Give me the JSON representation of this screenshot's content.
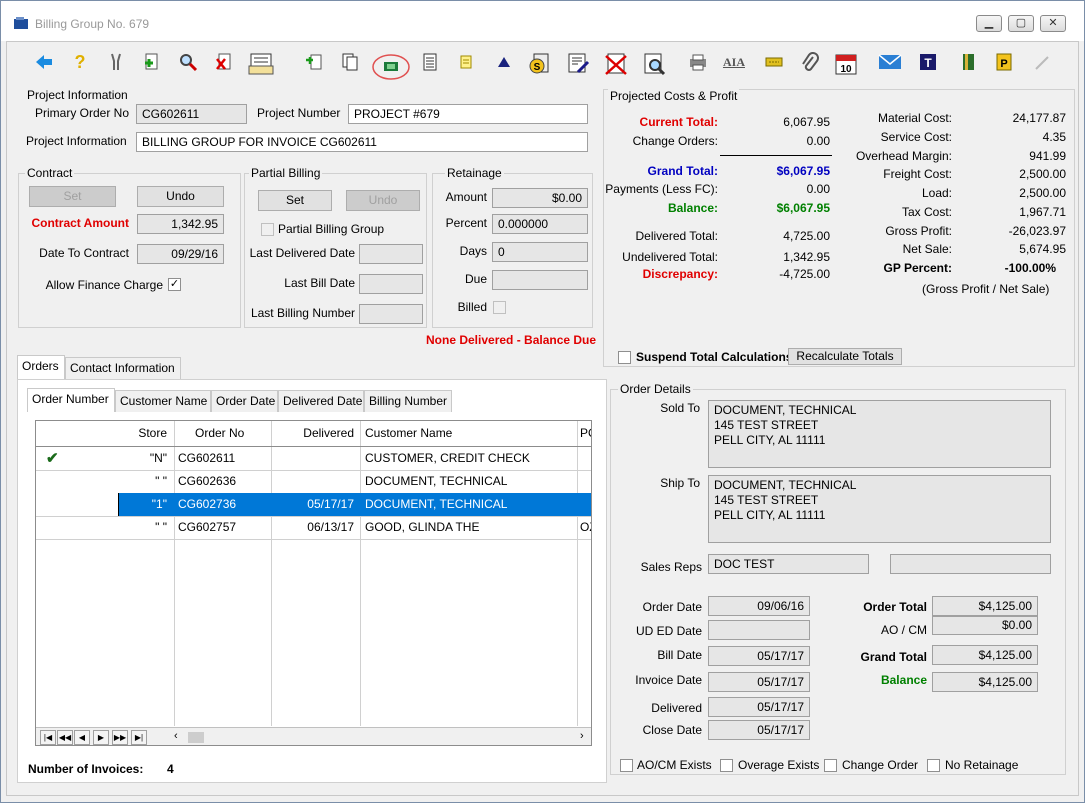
{
  "window": {
    "title": "Billing Group No. 679"
  },
  "toolbar": {
    "icons": [
      "back-arrow-icon",
      "help-icon",
      "tools-icon",
      "add-document-icon",
      "search-icon",
      "delete-document-icon",
      "report-stack-icon",
      "import-document-icon",
      "copy-documents-icon",
      "money-bill-icon",
      "document-lines-icon",
      "note-icon",
      "triangle-icon",
      "dollar-invoice-icon",
      "edit-document-icon",
      "cancel-document-icon",
      "preview-icon",
      "print-icon",
      "aia-icon",
      "ticket-icon",
      "paperclip-icon",
      "calendar-icon",
      "email-icon",
      "t-icon",
      "book-icon",
      "p-icon",
      "pencil-icon"
    ],
    "aia_label": "AIA",
    "calendar_label": "10"
  },
  "project_information": {
    "title": "Project Information",
    "primary_order_label": "Primary Order No",
    "primary_order_value": "CG602611",
    "project_number_label": "Project Number",
    "project_number_value": "PROJECT #679",
    "project_information_label": "Project Information",
    "project_information_value": "BILLING GROUP FOR INVOICE CG602611"
  },
  "contract": {
    "title": "Contract",
    "set_label": "Set",
    "undo_label": "Undo",
    "contract_amount_label": "Contract Amount",
    "contract_amount_value": "1,342.95",
    "date_to_contract_label": "Date To Contract",
    "date_to_contract_value": "09/29/16",
    "allow_finance_label": "Allow Finance Charge",
    "allow_finance_checked": "✓"
  },
  "partial_billing": {
    "title": "Partial Billing",
    "set_label": "Set",
    "undo_label": "Undo",
    "group_label": "Partial Billing Group",
    "last_delivered_label": "Last Delivered Date",
    "last_bill_label": "Last Bill Date",
    "last_billing_number_label": "Last Billing Number"
  },
  "retainage": {
    "title": "Retainage",
    "amount_label": "Amount",
    "amount_value": "$0.00",
    "percent_label": "Percent",
    "percent_value": "0.000000",
    "days_label": "Days",
    "days_value": "0",
    "due_label": "Due",
    "billed_label": "Billed"
  },
  "status_message": "None Delivered - Balance Due",
  "projected": {
    "title": "Projected Costs & Profit",
    "left": [
      {
        "label": "Current Total:",
        "value": "6,067.95"
      },
      {
        "label": "Change Orders:",
        "value": "0.00"
      },
      {
        "label": "Grand Total:",
        "value": "$6,067.95"
      },
      {
        "label": "Payments (Less FC):",
        "value": "0.00"
      },
      {
        "label": "Balance:",
        "value": "$6,067.95"
      },
      {
        "label": "Delivered Total:",
        "value": "4,725.00"
      },
      {
        "label": "Undelivered Total:",
        "value": "1,342.95"
      },
      {
        "label": "Discrepancy:",
        "value": "-4,725.00"
      }
    ],
    "right": [
      {
        "label": "Material Cost:",
        "value": "24,177.87"
      },
      {
        "label": "Service Cost:",
        "value": "4.35"
      },
      {
        "label": "Overhead Margin:",
        "value": "941.99"
      },
      {
        "label": "Freight Cost:",
        "value": "2,500.00"
      },
      {
        "label": "Load:",
        "value": "2,500.00"
      },
      {
        "label": "Tax Cost:",
        "value": "1,967.71"
      },
      {
        "label": "Gross Profit:",
        "value": "-26,023.97"
      },
      {
        "label": "Net Sale:",
        "value": "5,674.95"
      },
      {
        "label": "GP Percent:",
        "value": "-100.00%"
      }
    ],
    "gp_note": "(Gross Profit / Net Sale)",
    "suspend_label": "Suspend Total Calculations",
    "recalculate_label": "Recalculate Totals"
  },
  "main_tabs": [
    "Orders",
    "Contact Information"
  ],
  "order_tabs": [
    "Order Number",
    "Customer Name",
    "Order Date",
    "Delivered Date",
    "Billing Number"
  ],
  "grid": {
    "columns": [
      "Store",
      "Order No",
      "Delivered",
      "Customer Name",
      "PO"
    ],
    "rows": [
      {
        "mark": "✔",
        "store": "\"N\"",
        "order_no": "CG602611",
        "delivered": "",
        "customer": "CUSTOMER, CREDIT CHECK",
        "po": ""
      },
      {
        "mark": "",
        "store": "\" \"",
        "order_no": "CG602636",
        "delivered": "",
        "customer": "DOCUMENT, TECHNICAL",
        "po": ""
      },
      {
        "mark": "",
        "store": "\"1\"",
        "order_no": "CG602736",
        "delivered": "05/17/17",
        "customer": "DOCUMENT, TECHNICAL",
        "po": ""
      },
      {
        "mark": "",
        "store": "\" \"",
        "order_no": "CG602757",
        "delivered": "06/13/17",
        "customer": "GOOD, GLINDA THE",
        "po": "OZ"
      }
    ],
    "nav": [
      "|◀",
      "◀◀",
      "◀",
      "▶",
      "▶▶",
      "▶|"
    ]
  },
  "invoices": {
    "label": "Number of Invoices:",
    "value": "4"
  },
  "order_details": {
    "title": "Order Details",
    "sold_to_label": "Sold To",
    "sold_to": [
      "DOCUMENT, TECHNICAL",
      "145 TEST STREET",
      "PELL CITY, AL  11111"
    ],
    "ship_to_label": "Ship To",
    "ship_to": [
      "DOCUMENT, TECHNICAL",
      "145 TEST STREET",
      "PELL CITY, AL  11111"
    ],
    "sales_reps_label": "Sales Reps",
    "sales_reps_value": "DOC TEST",
    "order_date_label": "Order Date",
    "order_date_value": "09/06/16",
    "ud_ed_label": "UD ED Date",
    "bill_date_label": "Bill Date",
    "bill_date_value": "05/17/17",
    "invoice_date_label": "Invoice Date",
    "invoice_date_value": "05/17/17",
    "delivered_label": "Delivered",
    "delivered_value": "05/17/17",
    "close_date_label": "Close Date",
    "close_date_value": "05/17/17",
    "order_total_label": "Order Total",
    "order_total_value": "$4,125.00",
    "ao_cm_label": "AO / CM",
    "ao_cm_value": "$0.00",
    "grand_total_label": "Grand Total",
    "grand_total_value": "$4,125.00",
    "balance_label": "Balance",
    "balance_value": "$4,125.00",
    "checkboxes": [
      "AO/CM Exists",
      "Overage Exists",
      "Change Order",
      "No Retainage"
    ]
  },
  "colors": {
    "accent": "#0078d7",
    "red": "#e00000",
    "blue": "#0000c0",
    "green": "#008000"
  }
}
